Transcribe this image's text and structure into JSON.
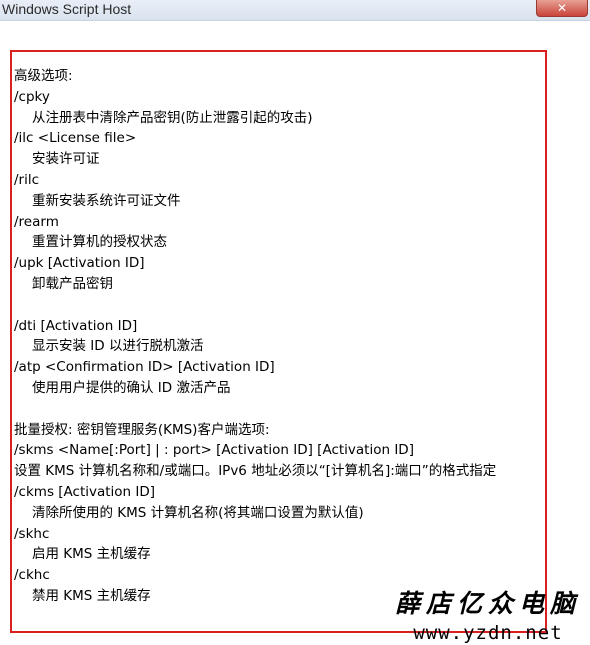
{
  "window": {
    "title": "Windows Script Host",
    "close_glyph": "✕"
  },
  "content": {
    "lines": [
      {
        "text": "高级选项:",
        "indent": false
      },
      {
        "text": "/cpky",
        "indent": false
      },
      {
        "text": "从注册表中清除产品密钥(防止泄露引起的攻击)",
        "indent": true
      },
      {
        "text": "/ilc <License file>",
        "indent": false
      },
      {
        "text": "安装许可证",
        "indent": true
      },
      {
        "text": "/rilc",
        "indent": false
      },
      {
        "text": "重新安装系统许可证文件",
        "indent": true
      },
      {
        "text": "/rearm",
        "indent": false
      },
      {
        "text": "重置计算机的授权状态",
        "indent": true
      },
      {
        "text": "/upk [Activation ID]",
        "indent": false
      },
      {
        "text": "卸载产品密钥",
        "indent": true
      },
      {
        "text": "",
        "indent": false
      },
      {
        "text": "/dti [Activation ID]",
        "indent": false
      },
      {
        "text": "显示安装 ID 以进行脱机激活",
        "indent": true
      },
      {
        "text": "/atp <Confirmation ID> [Activation ID]",
        "indent": false
      },
      {
        "text": "使用用户提供的确认 ID 激活产品",
        "indent": true
      },
      {
        "text": "",
        "indent": false
      },
      {
        "text": "批量授权: 密钥管理服务(KMS)客户端选项:",
        "indent": false
      },
      {
        "text": "/skms <Name[:Port] | : port> [Activation ID] [Activation ID]",
        "indent": false
      },
      {
        "text": "  设置 KMS 计算机名称和/或端口。IPv6 地址必须以“[计算机名]:端口”的格式指定",
        "indent": false,
        "wrap": true
      },
      {
        "text": "/ckms [Activation ID]",
        "indent": false
      },
      {
        "text": "清除所使用的 KMS 计算机名称(将其端口设置为默认值)",
        "indent": true
      },
      {
        "text": "/skhc",
        "indent": false
      },
      {
        "text": "启用 KMS 主机缓存",
        "indent": true
      },
      {
        "text": "/ckhc",
        "indent": false
      },
      {
        "text": "禁用 KMS 主机缓存",
        "indent": true
      }
    ]
  },
  "watermark": {
    "line1": "薛店亿众电脑",
    "line2": "www.yzdn.net"
  }
}
